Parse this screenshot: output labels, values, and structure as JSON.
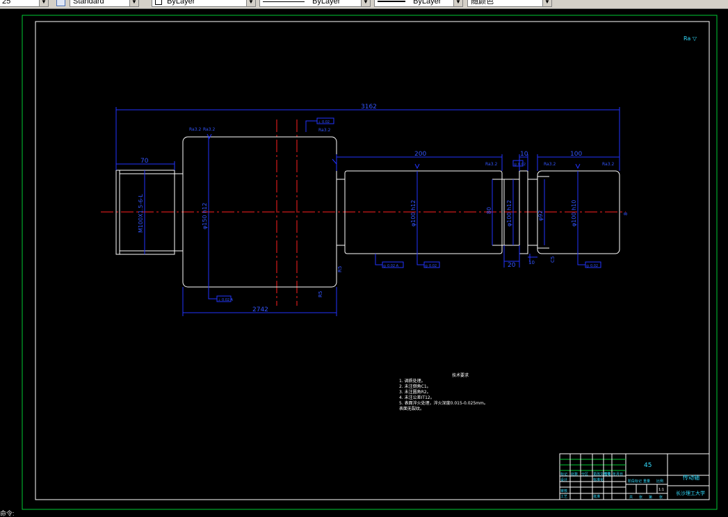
{
  "toolbar": {
    "scale_value": "25",
    "text_style": "Standard",
    "layer": "ByLayer",
    "linetype": "ByLayer",
    "lineweight": "ByLayer",
    "color": "随颜色"
  },
  "drawing": {
    "roughness_global": "Ra ▽",
    "dims": {
      "total_length": "3162",
      "body_length": "2742",
      "left_end": "70",
      "journal_a": "200",
      "shoulder_w": "10",
      "right_end": "100",
      "groove_w": "20",
      "small_w": "10",
      "dia_thread": "M100X1.5-6-L",
      "dia_roll": "φ150 h12",
      "dia_journal": "φ100 h12",
      "dia_neck": "φ100 h12",
      "dia_collar": "φ92",
      "dia_right": "φ100 h10",
      "offset_80": "80",
      "fillet_left": "R5",
      "fillet_right": "R5",
      "chamfer_e": "C5",
      "dim_8": "8"
    },
    "roughness": {
      "r1": "Ra3.2",
      "r2": "Ra3.2",
      "r3": "Ra3.2",
      "r4": "Ra3.2",
      "r5": "Ra3.2",
      "r6": "Ra3.2"
    },
    "gdt": {
      "g1": "⊥ 0.02 A",
      "g2": "⊥ 0.02",
      "g3": "◎ 0.02 A",
      "g4": "◎ 0.02",
      "g5": "◎ 0.02",
      "g6": "◎ 0.02"
    },
    "notes_title": "技术要求",
    "notes": [
      "1. 调质处理。",
      "2. 未注倒角C1。",
      "3. 未注圆角R2。",
      "4. 未注公差IT12。",
      "5. 表面淬火处理，淬火深度0.015-0.025mm。",
      "   表面无裂纹。"
    ],
    "title_block": {
      "material": "45",
      "part_name": "传动轴",
      "school": "长沙理工大学",
      "scale": "1:1",
      "row_labels": [
        "标记",
        "处数",
        "分区",
        "更改文件号",
        "签名",
        "年月日"
      ],
      "row_labels2": [
        "设计",
        "标准化",
        "审核",
        "工艺",
        "批准"
      ],
      "stage_labels": [
        "阶段标记",
        "重量",
        "比例"
      ],
      "sheet_labels": [
        "共",
        "张",
        "第",
        "张"
      ]
    }
  },
  "status_text": "命令:"
}
